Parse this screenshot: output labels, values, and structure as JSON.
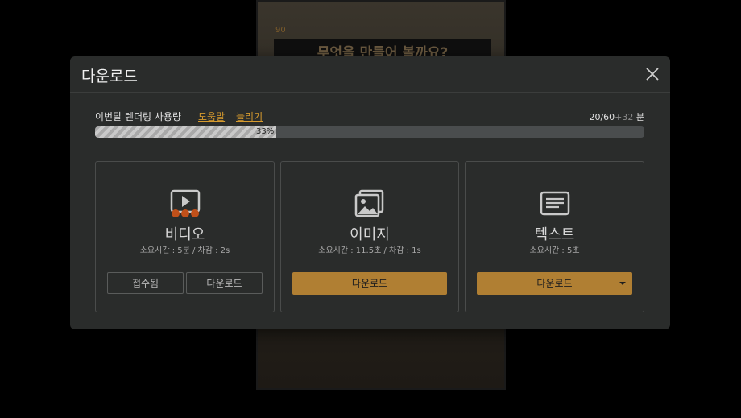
{
  "background": {
    "banner_text": "무엇을 만들어 볼까요?",
    "mark_text": "90"
  },
  "dialog": {
    "title": "다운로드",
    "close_icon": "close-icon"
  },
  "usage": {
    "label": "이번달 렌더링 사용량",
    "help_link": "도움말",
    "more_link": "늘리기",
    "used": "20/60",
    "extra": "+32",
    "unit": "분",
    "percent_label": "33%",
    "percent": 0.33
  },
  "cards": {
    "video": {
      "title": "비디오",
      "subtitle": "소요시간 : 5분 / 차감 : 2s",
      "received_label": "접수됨",
      "download_label": "다운로드",
      "icon": "video-play-icon"
    },
    "image": {
      "title": "이미지",
      "subtitle": "소요시간 : 11.5초 / 차감 : 1s",
      "download_label": "다운로드",
      "icon": "image-gallery-icon"
    },
    "text": {
      "title": "텍스트",
      "subtitle": "소요시간 : 5초",
      "download_label": "다운로드",
      "icon": "text-document-icon"
    }
  },
  "colors": {
    "accent": "#b07f33",
    "link": "#d69a2e",
    "dialog_bg": "#2a2c2b",
    "progress_dot": "#c0501a"
  }
}
